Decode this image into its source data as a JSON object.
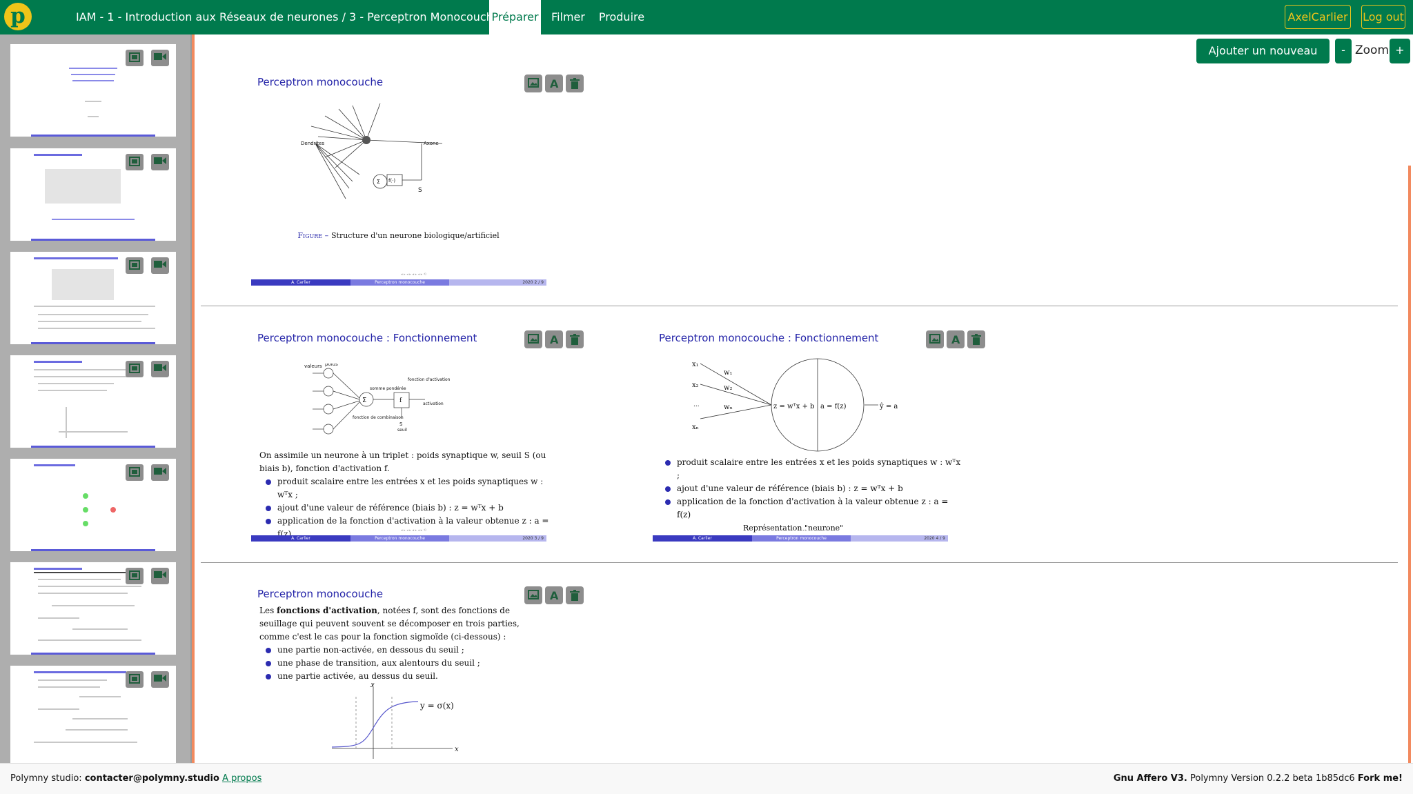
{
  "navbar": {
    "logo": "p",
    "breadcrumb": "IAM - 1 - Introduction aux Réseaux de neurones / 3 - Perceptron Monocouche",
    "tabs": [
      {
        "label": "Préparer",
        "active": true
      },
      {
        "label": "Filmer",
        "active": false
      },
      {
        "label": "Produire",
        "active": false
      }
    ],
    "user": "AxelCarlier",
    "logout": "Log out"
  },
  "toolbar": {
    "add_slide": "Ajouter un nouveau slide",
    "zoom_minus": "-",
    "zoom_label": "Zoom",
    "zoom_plus": "+"
  },
  "slides": [
    {
      "title": "Perceptron monocouche",
      "caption_prefix": "Figure –",
      "caption": "Structure d'un neurone biologique/artificiel",
      "diagram_labels": {
        "dendrites": "Dendrites",
        "axone": "Axone",
        "s": "S",
        "f": "f(·)",
        "sigma": "Σ"
      },
      "footer": {
        "author": "A. Carlier",
        "title": "Perceptron monocouche",
        "meta": "2020    2 / 9"
      }
    },
    {
      "title": "Perceptron monocouche : Fonctionnement",
      "intro": "On assimile un neurone à un triplet : poids synaptique w, seuil S (ou biais b), fonction d'activation f.",
      "bullets": [
        "produit scalaire entre les entrées x et les poids synaptiques w : wᵀx ;",
        "ajout d'une valeur de référence (biais b) : z = wᵀx + b",
        "application de la fonction d'activation à la valeur obtenue z : a = f(z)"
      ],
      "diagram_labels": {
        "valeurs": "valeurs",
        "poids": "poids",
        "somme": "somme pondérée",
        "fonction_combinaison": "fonction de combinaison",
        "fonction_activation": "fonction d'activation",
        "activation": "activation",
        "seuil": "seuil",
        "s": "S",
        "sigma": "Σ",
        "f": "f"
      },
      "footer": {
        "author": "A. Carlier",
        "title": "Perceptron monocouche",
        "meta": "2020    3 / 9"
      }
    },
    {
      "title": "Perceptron monocouche : Fonctionnement",
      "bullets": [
        "produit scalaire entre les entrées x et les poids synaptiques w : wᵀx ;",
        "ajout d'une valeur de référence (biais b) : z = wᵀx + b",
        "application de la fonction d'activation à la valeur obtenue z : a = f(z)"
      ],
      "caption": "Représentation \"neurone\"",
      "diagram_labels": {
        "x1": "x₁",
        "x2": "x₂",
        "dots": "...",
        "xn": "xₙ",
        "w1": "w₁",
        "w2": "w₂",
        "wn": "wₙ",
        "z": "z = wᵀx + b",
        "a": "a = f(z)",
        "yhat": "ŷ = a"
      },
      "footer": {
        "author": "A. Carlier",
        "title": "Perceptron monocouche",
        "meta": "2020    4 / 9"
      }
    },
    {
      "title": "Perceptron monocouche",
      "intro_pre": "Les ",
      "intro_bold": "fonctions d'activation",
      "intro_post": ", notées f, sont des fonctions de seuillage qui peuvent souvent se décomposer en trois parties, comme c'est le cas pour la fonction sigmoïde (ci-dessous) :",
      "bullets": [
        "une partie non-activée, en dessous du seuil ;",
        "une phase de transition, aux alentours du seuil ;",
        "une partie activée, au dessus du seuil."
      ],
      "plot_labels": {
        "y": "y",
        "x": "x",
        "curve": "y = σ(x)"
      }
    }
  ],
  "footer": {
    "studio_label": "Polymny studio:",
    "email": "contacter@polymny.studio",
    "about": "A propos",
    "license": "Gnu Affero V3.",
    "version": "Polymny Version 0.2.2 beta 1b85dc6",
    "fork": "Fork me!"
  },
  "colors": {
    "brand": "#007a4d",
    "accent": "#f0c419",
    "slide_title": "#2323a8",
    "gutter": "#f28a5f"
  }
}
